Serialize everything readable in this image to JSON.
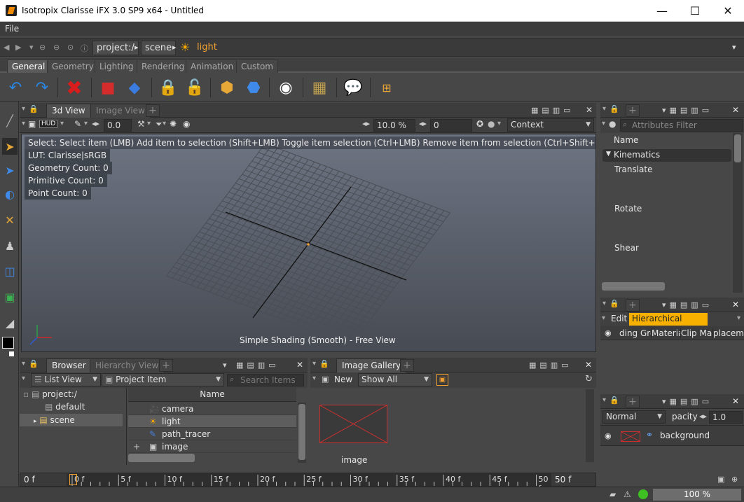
{
  "window": {
    "title": "Isotropix Clarisse iFX 3.0 SP9 x64  -  Untitled",
    "minimize": "—",
    "maximize": "☐",
    "close": "✕"
  },
  "menu": {
    "file": "File"
  },
  "address": {
    "crumbs": [
      "project:/",
      "scene",
      "light"
    ],
    "seps": [
      "▸",
      "▸"
    ]
  },
  "main_tabs": [
    "General",
    "Geometry",
    "Lighting",
    "Rendering",
    "Animation",
    "Custom"
  ],
  "viewport_panel": {
    "tabs": [
      "3d View",
      "Image View"
    ],
    "plus": "+",
    "hud": "HUD",
    "camera_value": "0.0",
    "zoom_value": "10.0 %",
    "frame_value": "0",
    "context_label": "Context",
    "info_line": "Select: Select item (LMB)  Add item to selection (Shift+LMB)  Toggle item selection (Ctrl+LMB)  Remove item from selection (Ctrl+Shift+LMB)  - Mode: Au",
    "lut": "LUT: Clarisse|sRGB",
    "geometry_count": "Geometry Count: 0",
    "primitive_count": "Primitive Count: 0",
    "point_count": "Point Count: 0",
    "shading_label": "Simple Shading (Smooth) - Free View"
  },
  "attributes_panel": {
    "filter_placeholder": "Attributes Filter",
    "name_label": "Name",
    "group": "Kinematics",
    "fields": [
      "Translate",
      "Rotate",
      "Shear"
    ]
  },
  "hier_panel": {
    "edit": "Edit",
    "hier_display": "Hierarchical Display",
    "columns": [
      "ding Gro",
      "Material",
      "Clip Map",
      "placem"
    ]
  },
  "layers_panel": {
    "blend": "Normal",
    "opacity_label": "pacity",
    "opacity_value": "1.0",
    "layer_name": "background"
  },
  "browser_panel": {
    "tabs": [
      "Browser",
      "Hierarchy View"
    ],
    "list_view": "List View",
    "project_item": "Project Item",
    "search_placeholder": "Search Items",
    "tree": [
      "project:/",
      "default",
      "scene"
    ],
    "name_header": "Name",
    "items": [
      "camera",
      "light",
      "path_tracer",
      "image"
    ]
  },
  "gallery_panel": {
    "tab": "Image Gallery",
    "new": "New",
    "show": "Show All",
    "image_label": "image"
  },
  "timeline": {
    "start": "0 f",
    "end": "50 f",
    "ticks": [
      "0 f",
      "5 f",
      "10 f",
      "15 f",
      "20 f",
      "25 f",
      "30 f",
      "35 f",
      "40 f",
      "45 f",
      "50 f"
    ]
  },
  "status": {
    "zoom": "100 %"
  },
  "colors": {
    "accent": "#f0a030",
    "bg": "#474747",
    "highlight": "#f7b000"
  }
}
